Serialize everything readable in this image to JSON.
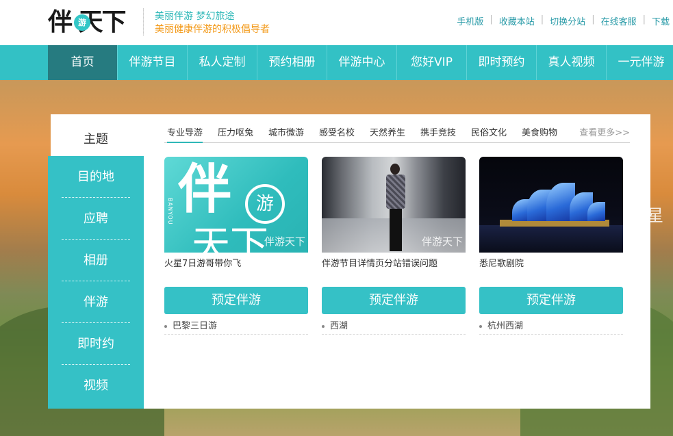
{
  "header": {
    "logo_text": "伴 天下",
    "logo_badge": "游",
    "slogan_primary": "美丽伴游 梦幻旅途",
    "slogan_secondary": "美丽健康伴游的积极倡导者",
    "top_links": [
      "手机版",
      "收藏本站",
      "切换分站",
      "在线客服",
      "下载"
    ]
  },
  "nav": {
    "items": [
      "首页",
      "伴游节目",
      "私人定制",
      "预约相册",
      "伴游中心",
      "您好VIP",
      "即时预约",
      "真人视频",
      "一元伴游"
    ],
    "active_index": 0
  },
  "background": {
    "side_text": "星"
  },
  "panel": {
    "theme_label": "主题",
    "sidebar": [
      "目的地",
      "应聘",
      "相册",
      "伴游",
      "即时约",
      "视频"
    ],
    "tabs": [
      "专业导游",
      "压力呕兔",
      "城市微游",
      "感受名校",
      "天然养生",
      "携手竞技",
      "民俗文化",
      "美食购物"
    ],
    "active_tab_index": 0,
    "more_link": "查看更多>>",
    "cards": [
      {
        "title": "火星7日游哥带你飞",
        "button": "预定伴游",
        "destination": "巴黎三日游",
        "watermark": "伴游天下",
        "image_text_top": "伴",
        "image_text_circle": "游",
        "image_text_bottom": "天下",
        "image_side_text": "BANYOU"
      },
      {
        "title": "伴游节目详情页分站错误问题",
        "button": "预定伴游",
        "destination": "西湖",
        "watermark": "伴游天下"
      },
      {
        "title": "悉尼歌剧院",
        "button": "预定伴游",
        "destination": "杭州西湖"
      }
    ]
  },
  "colors": {
    "accent": "#33c1c5",
    "nav_active": "#267b80",
    "slogan_teal": "#2fb8b8",
    "slogan_orange": "#f39a1a"
  }
}
